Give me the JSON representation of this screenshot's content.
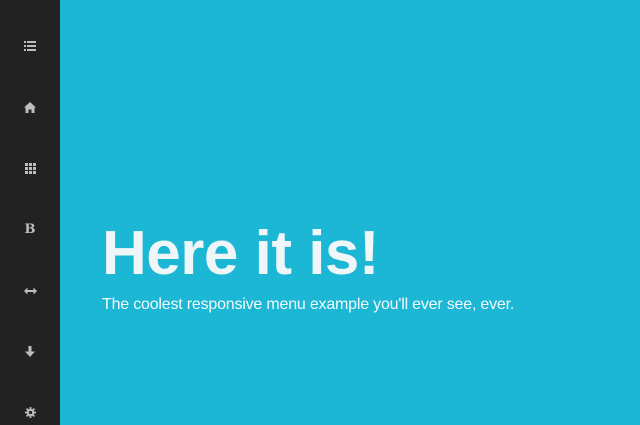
{
  "sidebar": {
    "items": [
      {
        "icon": "list-icon"
      },
      {
        "icon": "home-icon"
      },
      {
        "icon": "grid-icon"
      },
      {
        "icon": "bold-icon",
        "glyph": "B"
      },
      {
        "icon": "resize-horizontal-icon"
      },
      {
        "icon": "arrow-down-icon"
      },
      {
        "icon": "gear-icon"
      }
    ]
  },
  "hero": {
    "title": "Here it is!",
    "subtitle": "The coolest responsive menu example you'll ever see, ever."
  },
  "colors": {
    "sidebar_bg": "#222222",
    "main_bg": "#1bb7d5",
    "icon": "#bdbdbd",
    "text": "#eef6f8"
  }
}
